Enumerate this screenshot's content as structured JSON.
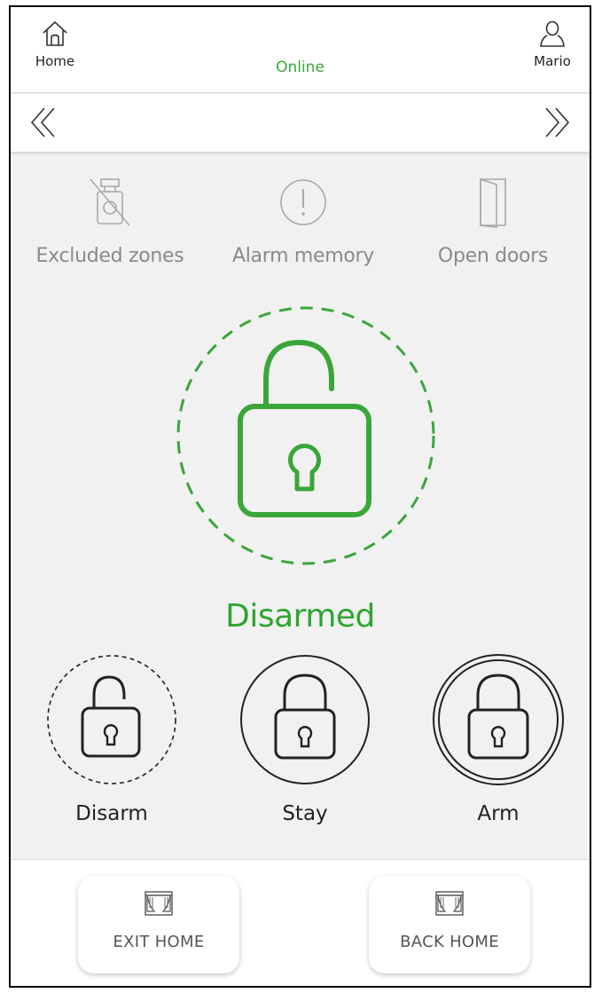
{
  "header": {
    "home_label": "Home",
    "connection_status": "Online",
    "user_name": "Mario"
  },
  "status_row": [
    {
      "icon": "excluded-zones-icon",
      "label": "Excluded zones"
    },
    {
      "icon": "alarm-memory-icon",
      "label": "Alarm memory"
    },
    {
      "icon": "open-doors-icon",
      "label": "Open doors"
    }
  ],
  "alarm": {
    "state": "Disarmed",
    "state_color": "#2ea52e"
  },
  "modes": [
    {
      "icon": "disarm-lock-icon",
      "label": "Disarm"
    },
    {
      "icon": "stay-lock-icon",
      "label": "Stay"
    },
    {
      "icon": "arm-lock-icon",
      "label": "Arm"
    }
  ],
  "scenarios": [
    {
      "icon": "curtains-icon",
      "label": "EXIT HOME"
    },
    {
      "icon": "curtains-icon",
      "label": "BACK HOME"
    }
  ],
  "colors": {
    "accent_green": "#3aa63a",
    "muted_gray": "#8a8a8a",
    "panel_bg": "#f1f1f1"
  }
}
